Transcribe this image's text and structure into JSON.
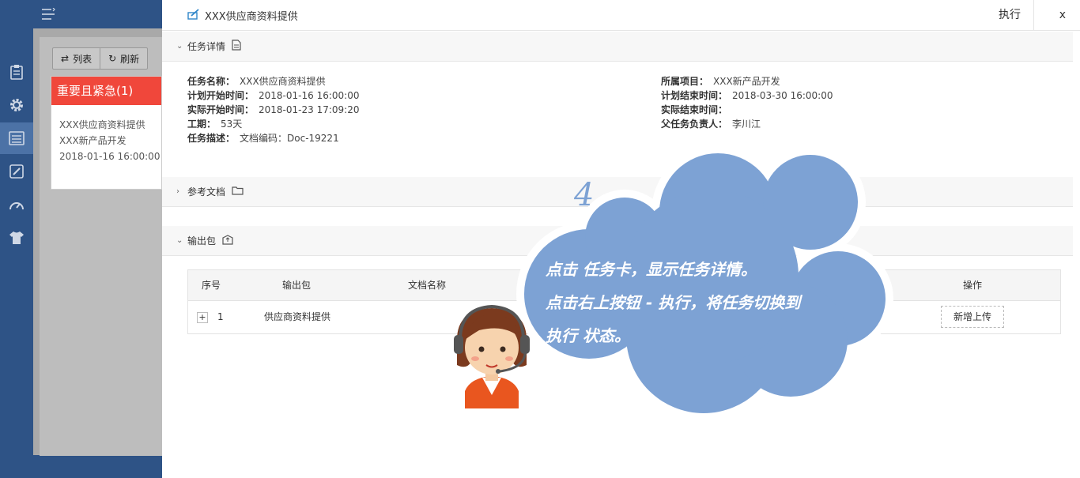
{
  "nav": {
    "items": [
      {
        "name": "clipboard-icon"
      },
      {
        "name": "gear-icon"
      },
      {
        "name": "list-icon",
        "active": true
      },
      {
        "name": "pencil-icon"
      },
      {
        "name": "speedometer-icon"
      },
      {
        "name": "shirt-icon"
      }
    ]
  },
  "toolbar": {
    "list_label": "列表",
    "refresh_label": "刷新"
  },
  "task_card": {
    "header": "重要且紧急(1)",
    "task_name": "XXX供应商资料提供",
    "project": "XXX新产品开发",
    "date": "2018-01-16 16:00:00"
  },
  "panel": {
    "title": "XXX供应商资料提供",
    "execute_label": "执行",
    "close_label": "x"
  },
  "details": {
    "section_label": "任务详情",
    "left": [
      {
        "key": "任务名称：",
        "value": "XXX供应商资料提供"
      },
      {
        "key": "计划开始时间：",
        "value": "2018-01-16 16:00:00"
      },
      {
        "key": "实际开始时间：",
        "value": "2018-01-23 17:09:20"
      },
      {
        "key": "工期：",
        "value": "53天"
      },
      {
        "key": "任务描述：",
        "value": "文档编码：Doc-19221"
      }
    ],
    "right": [
      {
        "key": "所属项目：",
        "value": "XXX新产品开发"
      },
      {
        "key": "计划结束时间：",
        "value": "2018-03-30 16:00:00"
      },
      {
        "key": "实际结束时间：",
        "value": ""
      },
      {
        "key": "父任务负责人：",
        "value": "李川江"
      }
    ]
  },
  "reference": {
    "section_label": "参考文档"
  },
  "output": {
    "section_label": "输出包",
    "columns": [
      "序号",
      "输出包",
      "文档名称",
      "操作"
    ],
    "rows": [
      {
        "index": "1",
        "package": "供应商资料提供",
        "expand": "+",
        "action": "新增上传"
      }
    ]
  },
  "tutorial": {
    "step": "4",
    "lines": [
      "点击 任务卡，显示任务详情。",
      "点击右上按钮 - 执行，将任务切换到",
      "执行 状态。"
    ]
  },
  "colors": {
    "nav_bg": "#2e5386",
    "nav_active": "#4c72a6",
    "card_header": "#f0473b",
    "cloud": "#7da2d4",
    "headset_hair": "#7b3a1e",
    "shirt": "#e9561f"
  }
}
